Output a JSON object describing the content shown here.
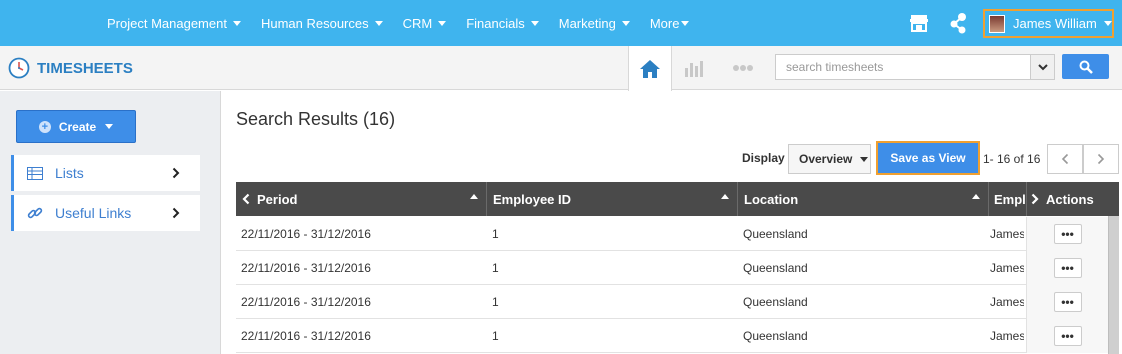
{
  "topnav": {
    "items": [
      {
        "label": "Project Management"
      },
      {
        "label": "Human Resources"
      },
      {
        "label": "CRM"
      },
      {
        "label": "Financials"
      },
      {
        "label": "Marketing"
      },
      {
        "label": "More"
      }
    ],
    "user_name": "James William",
    "icons": [
      "store-icon",
      "flow-icon"
    ],
    "accent": "#3fb4ee",
    "highlight": "#f0a030"
  },
  "header": {
    "app_title": "TIMESHEETS",
    "search_placeholder": "search timesheets",
    "view_tabs": [
      "home-icon",
      "chart-icon",
      "more-icon"
    ]
  },
  "sidebar": {
    "create_label": "Create",
    "items": [
      {
        "label": "Lists",
        "icon": "list-icon"
      },
      {
        "label": "Useful Links",
        "icon": "link-icon"
      }
    ]
  },
  "main": {
    "title": "Search Results (16)",
    "display_label": "Display",
    "display_value": "Overview",
    "save_view_label": "Save as View",
    "page_info": "1- 16 of 16"
  },
  "table": {
    "columns": [
      "Period",
      "Employee ID",
      "Location",
      "Emplo",
      "Actions"
    ],
    "rows": [
      {
        "period": "22/11/2016 - 31/12/2016",
        "employee_id": "1",
        "location": "Queensland",
        "employee": "James"
      },
      {
        "period": "22/11/2016 - 31/12/2016",
        "employee_id": "1",
        "location": "Queensland",
        "employee": "James"
      },
      {
        "period": "22/11/2016 - 31/12/2016",
        "employee_id": "1",
        "location": "Queensland",
        "employee": "James"
      },
      {
        "period": "22/11/2016 - 31/12/2016",
        "employee_id": "1",
        "location": "Queensland",
        "employee": "James"
      }
    ],
    "action_label": "•••"
  }
}
